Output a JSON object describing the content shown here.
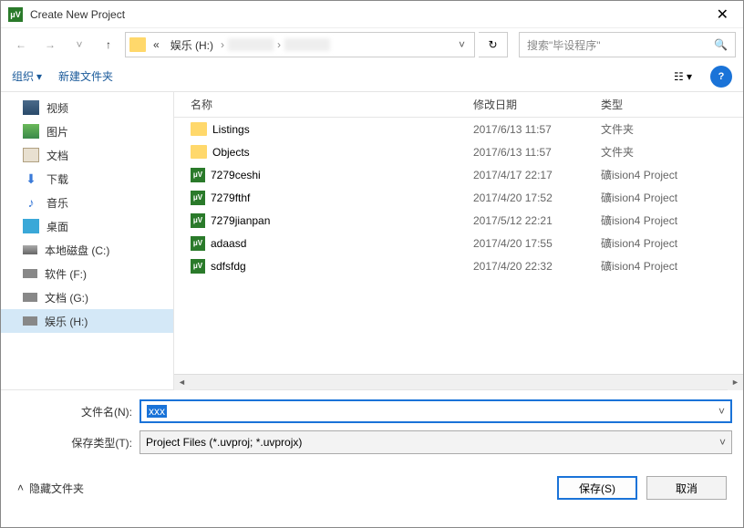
{
  "titlebar": {
    "title": "Create New Project"
  },
  "nav": {
    "crumb_prefix": "«",
    "crumb1": "娱乐 (H:)",
    "search_placeholder": "搜索\"毕设程序\""
  },
  "toolbar": {
    "organize": "组织",
    "newfolder": "新建文件夹"
  },
  "sidebar": {
    "items": [
      {
        "label": "视频",
        "ico": "video"
      },
      {
        "label": "图片",
        "ico": "pic"
      },
      {
        "label": "文档",
        "ico": "doc"
      },
      {
        "label": "下载",
        "ico": "down"
      },
      {
        "label": "音乐",
        "ico": "music"
      },
      {
        "label": "桌面",
        "ico": "desk"
      },
      {
        "label": "本地磁盘 (C:)",
        "ico": "diskc"
      },
      {
        "label": "软件 (F:)",
        "ico": "disk"
      },
      {
        "label": "文档 (G:)",
        "ico": "disk"
      },
      {
        "label": "娱乐 (H:)",
        "ico": "disk",
        "selected": true
      }
    ]
  },
  "columns": {
    "name": "名称",
    "date": "修改日期",
    "type": "类型"
  },
  "files": [
    {
      "name": "Listings",
      "date": "2017/6/13 11:57",
      "type": "文件夹",
      "ico": "folder"
    },
    {
      "name": "Objects",
      "date": "2017/6/13 11:57",
      "type": "文件夹",
      "ico": "folder"
    },
    {
      "name": "7279ceshi",
      "date": "2017/4/17 22:17",
      "type": "礦ision4 Project",
      "ico": "uv"
    },
    {
      "name": "7279fthf",
      "date": "2017/4/20 17:52",
      "type": "礦ision4 Project",
      "ico": "uv"
    },
    {
      "name": "7279jianpan",
      "date": "2017/5/12 22:21",
      "type": "礦ision4 Project",
      "ico": "uv"
    },
    {
      "name": "adaasd",
      "date": "2017/4/20 17:55",
      "type": "礦ision4 Project",
      "ico": "uv"
    },
    {
      "name": "sdfsfdg",
      "date": "2017/4/20 22:32",
      "type": "礦ision4 Project",
      "ico": "uv"
    }
  ],
  "form": {
    "filename_label": "文件名(N):",
    "filename_value": "xxx",
    "savetype_label": "保存类型(T):",
    "savetype_value": "Project Files (*.uvproj; *.uvprojx)"
  },
  "bottom": {
    "hide_folders": "隐藏文件夹",
    "save": "保存(S)",
    "cancel": "取消"
  }
}
